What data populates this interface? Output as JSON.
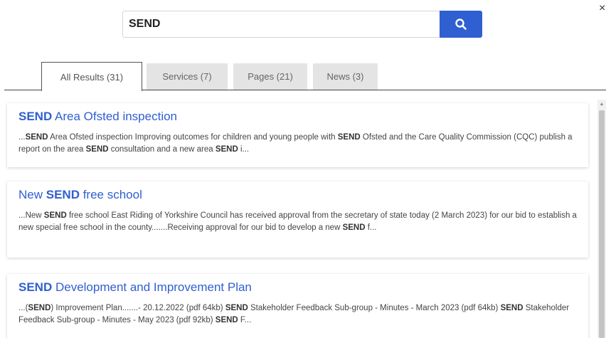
{
  "close_label": "×",
  "search": {
    "value": "SEND",
    "icon": "search-icon"
  },
  "tabs": [
    {
      "label": "All Results (31)",
      "active": true
    },
    {
      "label": "Services (7)",
      "active": false
    },
    {
      "label": "Pages (21)",
      "active": false
    },
    {
      "label": "News (3)",
      "active": false
    }
  ],
  "results": [
    {
      "title": [
        {
          "b": true,
          "t": "SEND"
        },
        {
          "b": false,
          "t": " Area Ofsted inspection"
        }
      ],
      "snippet": [
        {
          "b": false,
          "t": "..."
        },
        {
          "b": true,
          "t": "SEND"
        },
        {
          "b": false,
          "t": " Area Ofsted inspection Improving outcomes for children and young people with "
        },
        {
          "b": true,
          "t": "SEND"
        },
        {
          "b": false,
          "t": " Ofsted and the Care Quality Commission (CQC) publish a report on the area "
        },
        {
          "b": true,
          "t": "SEND"
        },
        {
          "b": false,
          "t": " consultation and a new area "
        },
        {
          "b": true,
          "t": "SEND"
        },
        {
          "b": false,
          "t": " i..."
        }
      ]
    },
    {
      "title": [
        {
          "b": false,
          "t": "New "
        },
        {
          "b": true,
          "t": "SEND"
        },
        {
          "b": false,
          "t": " free school"
        }
      ],
      "snippet": [
        {
          "b": false,
          "t": "...New "
        },
        {
          "b": true,
          "t": "SEND"
        },
        {
          "b": false,
          "t": " free school East Riding of Yorkshire Council has received approval from the secretary of state today (2 March 2023) for our bid to establish a new special free school in the county.......Receiving approval for our bid to develop a new "
        },
        {
          "b": true,
          "t": "SEND"
        },
        {
          "b": false,
          "t": " f..."
        }
      ]
    },
    {
      "title": [
        {
          "b": true,
          "t": "SEND"
        },
        {
          "b": false,
          "t": " Development and Improvement Plan"
        }
      ],
      "snippet": [
        {
          "b": false,
          "t": "...("
        },
        {
          "b": true,
          "t": "SEND"
        },
        {
          "b": false,
          "t": ") Improvement Plan.......- 20.12.2022 (pdf 64kb) "
        },
        {
          "b": true,
          "t": "SEND"
        },
        {
          "b": false,
          "t": " Stakeholder Feedback Sub-group - Minutes - March 2023 (pdf 64kb) "
        },
        {
          "b": true,
          "t": "SEND"
        },
        {
          "b": false,
          "t": " Stakeholder Feedback Sub-group - Minutes - May 2023 (pdf 92kb) "
        },
        {
          "b": true,
          "t": "SEND"
        },
        {
          "b": false,
          "t": " F..."
        }
      ]
    }
  ],
  "colors": {
    "accent": "#2f5fd0",
    "tab_inactive_bg": "#e4e4e4"
  }
}
